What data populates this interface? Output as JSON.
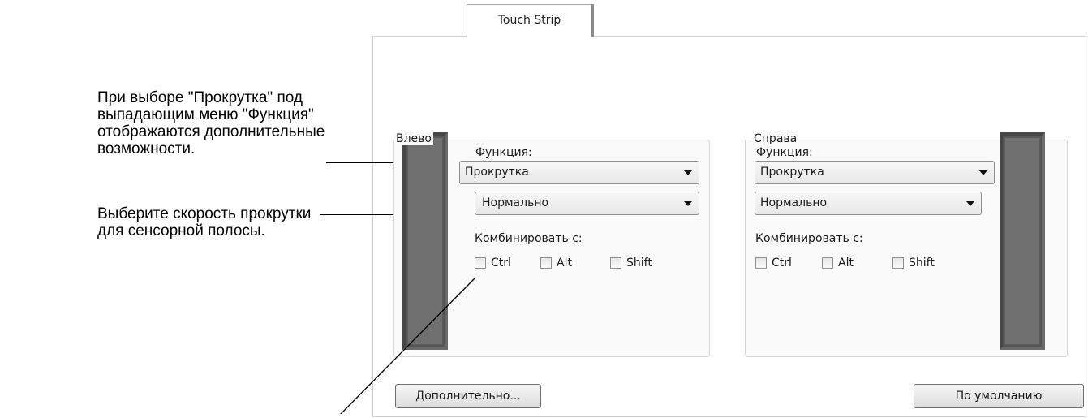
{
  "tab": {
    "label": "Touch Strip"
  },
  "callouts": {
    "function_note": "При выборе \"Прокрутка\" под выпадающим меню \"Функция\" отображаются дополнительные возможности.",
    "speed_note": "Выберите скорость прокрутки для сенсорной полосы."
  },
  "left_group": {
    "title": "Влево",
    "function_label": "Функция:",
    "function_value": "Прокрутка",
    "speed_value": "Нормально",
    "combine_label": "Комбинировать с:",
    "modifiers": [
      "Ctrl",
      "Alt",
      "Shift"
    ]
  },
  "right_group": {
    "title": "Справа",
    "function_label": "Функция:",
    "function_value": "Прокрутка",
    "speed_value": "Нормально",
    "combine_label": "Комбинировать с:",
    "modifiers": [
      "Ctrl",
      "Alt",
      "Shift"
    ]
  },
  "buttons": {
    "advanced": "Дополнительно...",
    "default": "По умолчанию"
  },
  "icons": {
    "dropdown_arrow": "chevron-down-icon",
    "strip": "touch-strip-icon"
  }
}
